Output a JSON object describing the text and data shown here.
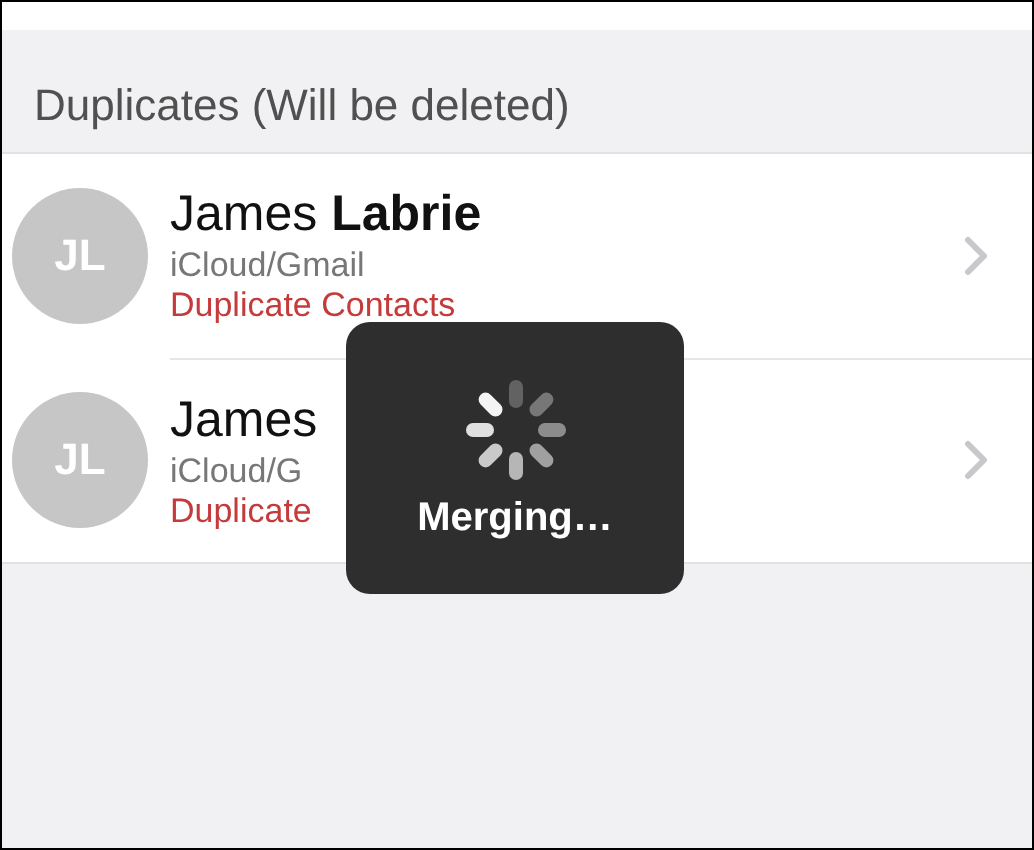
{
  "section_header": "Duplicates (Will be deleted)",
  "contacts": [
    {
      "initials": "JL",
      "name": "James **Labrie**",
      "accounts": "iCloud/Gmail",
      "status": "Duplicate Contacts"
    },
    {
      "initials": "JL",
      "name": "James",
      "accounts": "iCloud/G",
      "status": "Duplicate"
    }
  ],
  "hud": {
    "label": "Merging…"
  }
}
